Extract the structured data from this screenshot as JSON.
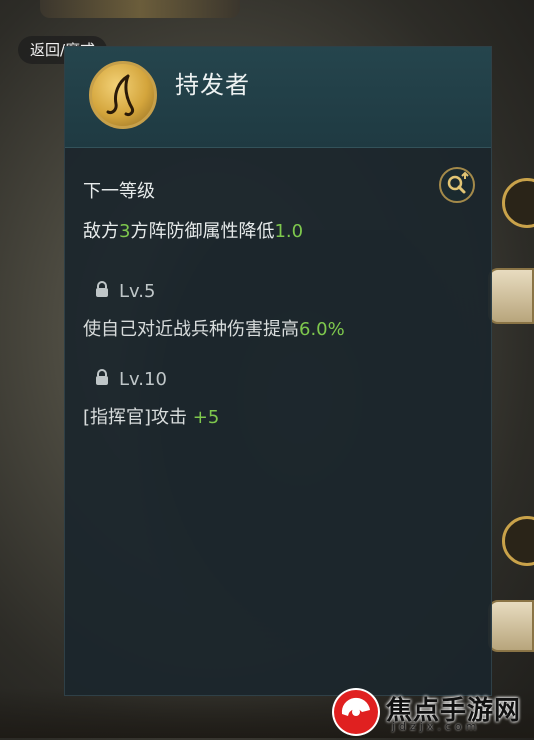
{
  "nav": {
    "back_label": "返回/魔戒"
  },
  "skill": {
    "title": "持发者",
    "icon": "skill-emblem-icon"
  },
  "next_level": {
    "heading": "下一等级",
    "effect_prefix": "敌方",
    "effect_count": "3",
    "effect_middle": "方阵防御属性降低",
    "effect_value": "1.0"
  },
  "levels": [
    {
      "level": "Lv.5",
      "desc_prefix": "使自己对近战兵种伤害提高",
      "desc_value": "6.0%"
    },
    {
      "level": "Lv.10",
      "desc_prefix": "[指挥官]攻击 ",
      "desc_value": "+5"
    }
  ],
  "watermark": {
    "text": "焦点手游网",
    "sub": "jdzjx.com"
  },
  "colors": {
    "highlight": "#7ec84d",
    "panel_bg": "#1b262c",
    "gold": "#c7a04a"
  }
}
